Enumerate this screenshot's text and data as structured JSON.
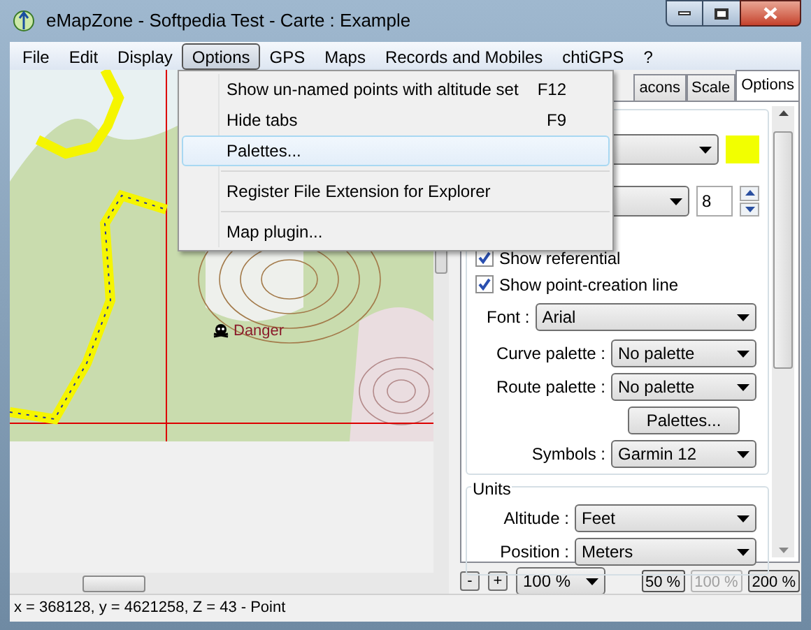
{
  "window": {
    "title": "eMapZone - Softpedia Test - Carte : Example"
  },
  "menu_bar": [
    {
      "label": "File",
      "selected": false
    },
    {
      "label": "Edit",
      "selected": false
    },
    {
      "label": "Display",
      "selected": false
    },
    {
      "label": "Options",
      "selected": true
    },
    {
      "label": "GPS",
      "selected": false
    },
    {
      "label": "Maps",
      "selected": false
    },
    {
      "label": "Records and Mobiles",
      "selected": false
    },
    {
      "label": "chtiGPS",
      "selected": false
    },
    {
      "label": "?",
      "selected": false
    }
  ],
  "dropdown_menu": [
    {
      "kind": "item",
      "label": "Show un-named points with altitude set",
      "shortcut": "F12",
      "selected": false
    },
    {
      "kind": "item",
      "label": "Hide tabs",
      "shortcut": "F9",
      "selected": false
    },
    {
      "kind": "item",
      "label": "Palettes...",
      "selected": true
    },
    {
      "kind": "separator"
    },
    {
      "kind": "item",
      "label": "Register File Extension for Explorer",
      "selected": false
    },
    {
      "kind": "separator"
    },
    {
      "kind": "item",
      "label": "Map plugin...",
      "selected": false
    }
  ],
  "map": {
    "waypoint_label": "Danger"
  },
  "tabs": [
    {
      "label": "acons",
      "selected": false
    },
    {
      "label": "Scale",
      "selected": false
    },
    {
      "label": "Options",
      "selected": true
    }
  ],
  "options": {
    "color_swatch": {
      "color": "#f2ff00"
    },
    "size_field": {
      "value": "8"
    },
    "checkboxes": [
      {
        "label": "Show referential",
        "checked": true
      },
      {
        "label": "Show point-creation line",
        "checked": true
      }
    ],
    "rows": [
      {
        "kind": "wide_select",
        "label": "Font :",
        "value": "Arial"
      },
      {
        "kind": "select",
        "label": "Curve palette :",
        "value": "No palette"
      },
      {
        "kind": "select",
        "label": "Route palette :",
        "value": "No palette"
      },
      {
        "kind": "button",
        "label": "Palettes..."
      },
      {
        "kind": "select",
        "label": "Symbols :",
        "value": "Garmin 12"
      }
    ],
    "units": {
      "title": "Units",
      "rows": [
        {
          "kind": "select",
          "label": "Altitude :",
          "value": "Feet"
        },
        {
          "kind": "select",
          "label": "Position :",
          "value": "Meters"
        }
      ]
    }
  },
  "zoom_bar": {
    "minus": "-",
    "plus": "+",
    "zoom_select": "100 %",
    "buttons": [
      {
        "label": "50 %",
        "disabled": false
      },
      {
        "label": "100 %",
        "disabled": true
      },
      {
        "label": "200 %",
        "disabled": false
      }
    ]
  },
  "status_bar": "x = 368128, y = 4621258, Z = 43 - Point"
}
